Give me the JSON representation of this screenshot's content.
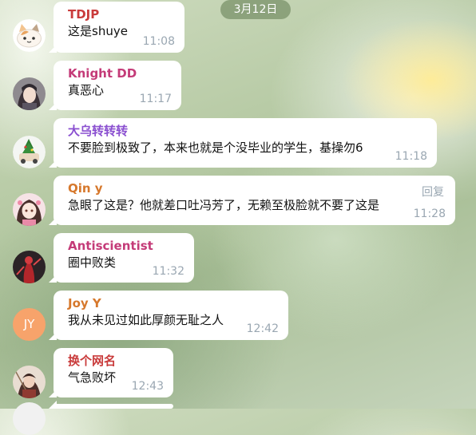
{
  "date_badge": "3月12日",
  "messages": [
    {
      "sender": "TDJP",
      "text": "这是shuye",
      "time": "11:08",
      "color": "#c93b3b"
    },
    {
      "sender": "Knight DD",
      "text": "真恶心",
      "time": "11:17",
      "color": "#c43b78"
    },
    {
      "sender": "大乌转转转",
      "text": "不要脸到极致了，本来也就是个没毕业的学生，基操勿6",
      "time": "11:18",
      "color": "#8a4fd0"
    },
    {
      "sender": "Qin y",
      "text": "急眼了这是？他就差口吐冯芳了，无赖至极脸就不要了这是",
      "time": "11:28",
      "reply": "回复",
      "color": "#d6782c"
    },
    {
      "sender": "Antiscientist",
      "text": "圈中败类",
      "time": "11:32",
      "color": "#c43b78"
    },
    {
      "sender": "Joy Y",
      "text": "我从未见过如此厚颜无耻之人",
      "time": "12:42",
      "initials": "JY",
      "color": "#d6782c"
    },
    {
      "sender": "换个网名",
      "text": "气急败坏",
      "time": "12:43",
      "color": "#c93b3b"
    }
  ],
  "avatars": [
    {
      "icon": "cat-avatar-icon"
    },
    {
      "icon": "anime-girl-avatar-icon"
    },
    {
      "icon": "car-avatar-icon"
    },
    {
      "icon": "anime-girl-pink-avatar-icon"
    },
    {
      "icon": "red-figure-avatar-icon"
    },
    {
      "initials_bg": "#f7a36b"
    },
    {
      "icon": "warrior-avatar-icon"
    }
  ]
}
